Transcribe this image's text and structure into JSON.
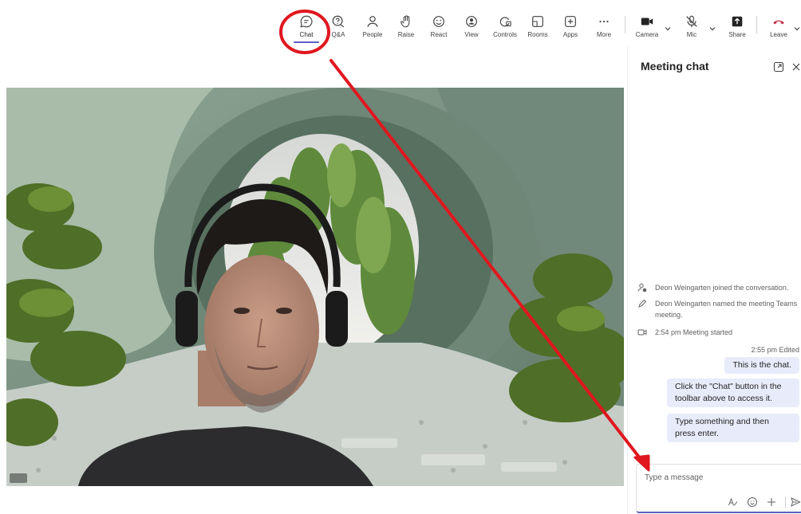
{
  "toolbar": {
    "items": [
      {
        "label": "Chat",
        "icon": "chat-icon"
      },
      {
        "label": "Q&A",
        "icon": "qa-icon"
      },
      {
        "label": "People",
        "icon": "people-icon"
      },
      {
        "label": "Raise",
        "icon": "raise-hand-icon"
      },
      {
        "label": "React",
        "icon": "react-icon"
      },
      {
        "label": "View",
        "icon": "view-icon"
      },
      {
        "label": "Controls",
        "icon": "controls-icon"
      },
      {
        "label": "Rooms",
        "icon": "rooms-icon"
      },
      {
        "label": "Apps",
        "icon": "apps-icon"
      },
      {
        "label": "More",
        "icon": "more-icon"
      },
      {
        "label": "Camera",
        "icon": "camera-icon"
      },
      {
        "label": "Mic",
        "icon": "mic-off-icon"
      },
      {
        "label": "Share",
        "icon": "share-icon"
      },
      {
        "label": "Leave",
        "icon": "leave-icon"
      }
    ],
    "active": "Chat"
  },
  "chat": {
    "title": "Meeting chat",
    "events": [
      {
        "icon": "person-joined-icon",
        "text": "Deon Weingarten joined the conversation."
      },
      {
        "icon": "pencil-icon",
        "text": "Deon Weingarten named the meeting Teams meeting."
      },
      {
        "icon": "video-camera-icon",
        "text": "2:54 pm   Meeting started"
      }
    ],
    "message_meta": "2:55 pm  Edited",
    "messages": [
      "This is the chat.",
      "Click the \"Chat\" button in the toolbar above to access it.",
      "Type something and then press enter."
    ],
    "composer_placeholder": "Type a message"
  },
  "colors": {
    "accent": "#5b5fc7",
    "leave": "#c4314b",
    "annotation": "#e0171f",
    "bubble": "#e8ebfa"
  }
}
